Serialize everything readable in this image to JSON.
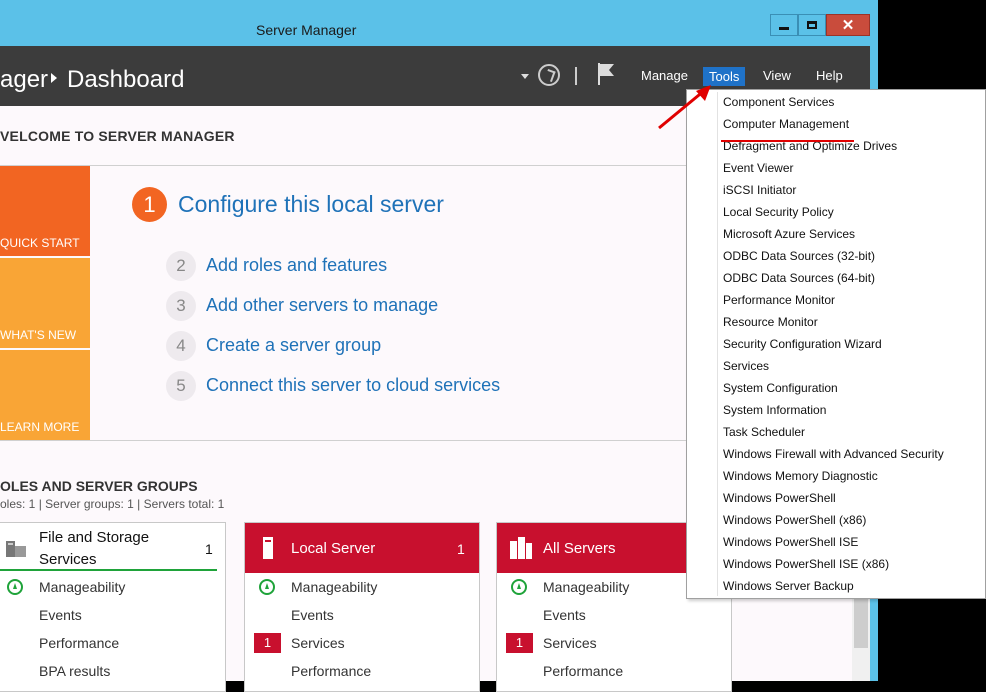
{
  "window": {
    "title": "Server Manager",
    "controls": {
      "minimize": "",
      "maximize": "",
      "close": "✕"
    }
  },
  "header": {
    "breadcrumb_prefix": "ager",
    "breadcrumb_current": "Dashboard",
    "menu": {
      "manage": "Manage",
      "tools": "Tools",
      "view": "View",
      "help": "Help"
    }
  },
  "welcome": {
    "title": "VELCOME TO SERVER MANAGER",
    "tiles": {
      "quick_start": "QUICK START",
      "whats_new": "WHAT'S NEW",
      "learn_more": "LEARN MORE"
    },
    "steps": [
      {
        "num": "1",
        "label": "Configure this local server"
      },
      {
        "num": "2",
        "label": "Add roles and features"
      },
      {
        "num": "3",
        "label": "Add other servers to manage"
      },
      {
        "num": "4",
        "label": "Create a server group"
      },
      {
        "num": "5",
        "label": "Connect this server to cloud services"
      }
    ]
  },
  "roles": {
    "title": "OLES AND SERVER GROUPS",
    "summary": "oles: 1   |   Server groups: 1   |   Servers total: 1"
  },
  "cards": {
    "file_storage": {
      "title_line1": "File and Storage",
      "title_line2": "Services",
      "count": "1",
      "rows": [
        "Manageability",
        "Events",
        "Performance",
        "BPA results"
      ]
    },
    "local_server": {
      "title": "Local Server",
      "count": "1",
      "rows": [
        "Manageability",
        "Events",
        "Services",
        "Performance"
      ],
      "services_badge": "1"
    },
    "all_servers": {
      "title": "All Servers",
      "rows": [
        "Manageability",
        "Events",
        "Services",
        "Performance"
      ],
      "services_badge": "1"
    }
  },
  "tools_menu": {
    "items": [
      "Component Services",
      "Computer Management",
      "Defragment and Optimize Drives",
      "Event Viewer",
      "iSCSI Initiator",
      "Local Security Policy",
      "Microsoft Azure Services",
      "ODBC Data Sources (32-bit)",
      "ODBC Data Sources (64-bit)",
      "Performance Monitor",
      "Resource Monitor",
      "Security Configuration Wizard",
      "Services",
      "System Configuration",
      "System Information",
      "Task Scheduler",
      "Windows Firewall with Advanced Security",
      "Windows Memory Diagnostic",
      "Windows PowerShell",
      "Windows PowerShell (x86)",
      "Windows PowerShell ISE",
      "Windows PowerShell ISE (x86)",
      "Windows Server Backup"
    ]
  },
  "colors": {
    "title_bar": "#5bc1e8",
    "header": "#3c3c3c",
    "tools_active": "#1f72c8",
    "quick_start": "#f26522",
    "tile_orange": "#f9a536",
    "card_red": "#c8102e",
    "link_blue": "#1f72b8",
    "annotation_red": "#e00000",
    "annotation_green": "#1fa33a"
  }
}
